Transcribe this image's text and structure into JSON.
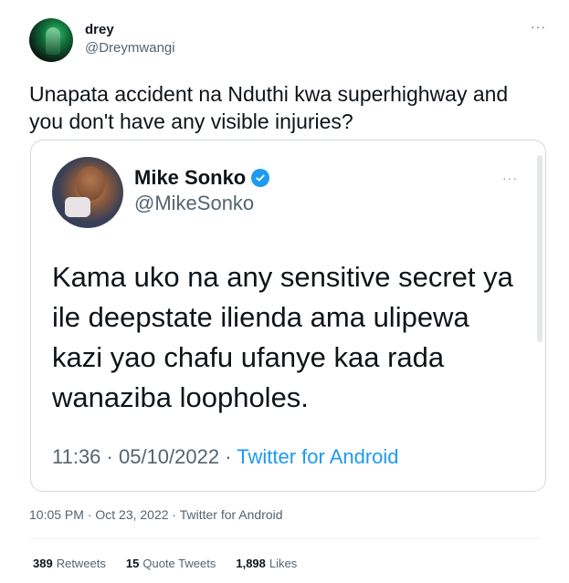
{
  "tweet": {
    "author": {
      "display_name": "drey",
      "handle": "@Dreymwangi"
    },
    "more": "···",
    "text": "Unapata accident na Nduthi kwa superhighway and you don't have any visible injuries?",
    "time": "10:05 PM · Oct 23, 2022 · Twitter for Android",
    "stats": {
      "retweets_count": "389",
      "retweets_label": "Retweets",
      "quotes_count": "15",
      "quotes_label": "Quote Tweets",
      "likes_count": "1,898",
      "likes_label": "Likes"
    }
  },
  "quoted": {
    "display_name": "Mike Sonko",
    "handle": "@MikeSonko",
    "more": "···",
    "text": "Kama uko na any sensitive secret ya ile deepstate ilienda ama ulipewa kazi yao chafu ufanye kaa rada wanaziba loopholes.",
    "time": "11:36 · 05/10/2022 · ",
    "source": "Twitter for Android"
  },
  "colors": {
    "accent": "#1d9bf0",
    "muted": "#536471",
    "text": "#0f1419",
    "border": "#cfd9de"
  }
}
